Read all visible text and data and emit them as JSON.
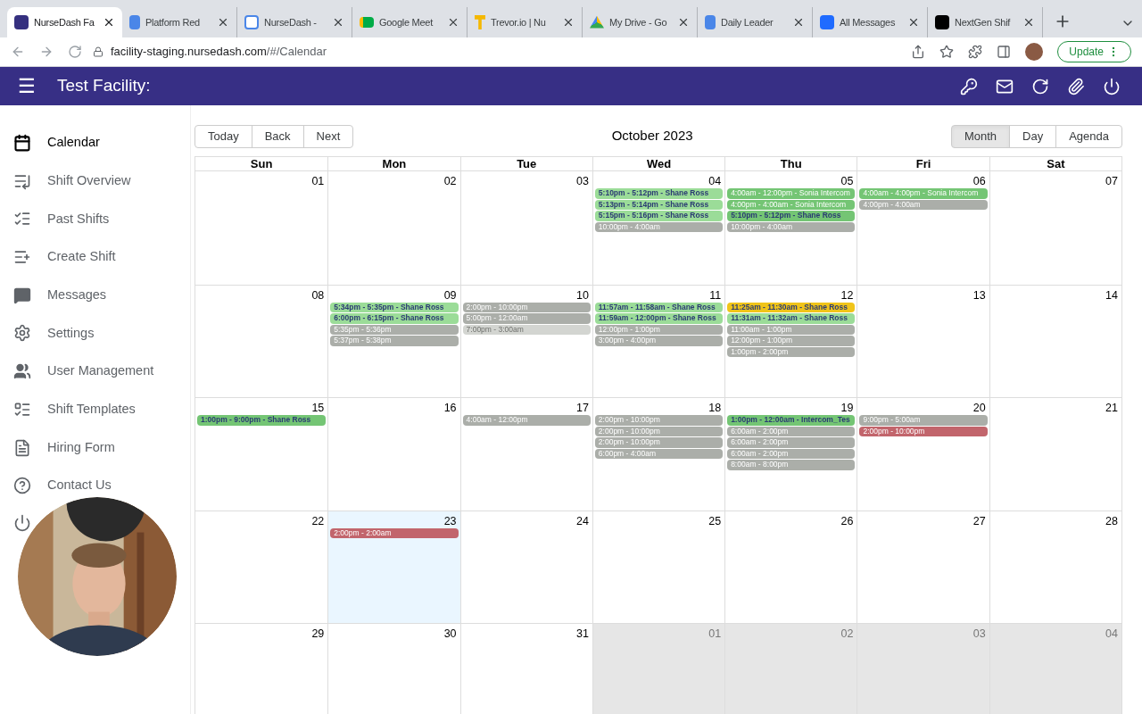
{
  "browser": {
    "tabs": [
      {
        "title": "NurseDash Fa",
        "selected": true
      },
      {
        "title": "Platform Red",
        "selected": false
      },
      {
        "title": "NurseDash -",
        "selected": false
      },
      {
        "title": "Google Meet",
        "selected": false
      },
      {
        "title": "Trevor.io | Nu",
        "selected": false
      },
      {
        "title": "My Drive - Go",
        "selected": false
      },
      {
        "title": "Daily Leader",
        "selected": false
      },
      {
        "title": "All Messages",
        "selected": false
      },
      {
        "title": "NextGen Shif",
        "selected": false
      }
    ],
    "url_host": "facility-staging.nursedash.com",
    "url_path": "/#/Calendar",
    "update_button": "Update"
  },
  "header": {
    "menu_icon": "☰",
    "title": "Test Facility:"
  },
  "sidebar": {
    "items": [
      {
        "label": "Calendar",
        "selected": true
      },
      {
        "label": "Shift Overview",
        "selected": false
      },
      {
        "label": "Past Shifts",
        "selected": false
      },
      {
        "label": "Create Shift",
        "selected": false
      },
      {
        "label": "Messages",
        "selected": false
      },
      {
        "label": "Settings",
        "selected": false
      },
      {
        "label": "User Management",
        "selected": false
      },
      {
        "label": "Shift Templates",
        "selected": false
      },
      {
        "label": "Hiring Form",
        "selected": false
      },
      {
        "label": "Contact Us",
        "selected": false
      }
    ]
  },
  "calendar": {
    "nav": [
      "Today",
      "Back",
      "Next"
    ],
    "title": "October 2023",
    "views": [
      {
        "label": "Month",
        "selected": true
      },
      {
        "label": "Day",
        "selected": false
      },
      {
        "label": "Agenda",
        "selected": false
      }
    ],
    "weekdays": [
      "Sun",
      "Mon",
      "Tue",
      "Wed",
      "Thu",
      "Fri",
      "Sat"
    ],
    "cells": [
      {
        "day": "01",
        "other_month": false,
        "today": false
      },
      {
        "day": "02",
        "other_month": false,
        "today": false
      },
      {
        "day": "03",
        "other_month": false,
        "today": false
      },
      {
        "day": "04",
        "other_month": false,
        "today": false,
        "events": [
          {
            "text": "5:10pm - 5:12pm - Shane Ross",
            "color": "#9bdc98",
            "kind": "bold"
          },
          {
            "text": "5:13pm - 5:14pm - Shane Ross",
            "color": "#9bdc98",
            "kind": "bold"
          },
          {
            "text": "5:15pm - 5:16pm - Shane Ross",
            "color": "#9bdc98",
            "kind": "bold"
          },
          {
            "text": "10:00pm - 4:00am",
            "color": "#abaea9",
            "kind": "plain"
          }
        ]
      },
      {
        "day": "05",
        "other_month": false,
        "today": false,
        "events": [
          {
            "text": "4:00am - 12:00pm - Sonia Intercom",
            "color": "#74c574",
            "kind": "plain"
          },
          {
            "text": "4:00pm - 4:00am - Sonia Intercom",
            "color": "#74c574",
            "kind": "plain"
          },
          {
            "text": "5:10pm - 5:12pm - Shane Ross",
            "color": "#74c574",
            "kind": "bold"
          },
          {
            "text": "10:00pm - 4:00am",
            "color": "#abaea9",
            "kind": "plain"
          }
        ]
      },
      {
        "day": "06",
        "other_month": false,
        "today": false,
        "events": [
          {
            "text": "4:00am - 4:00pm - Sonia Intercom",
            "color": "#74c574",
            "kind": "plain"
          },
          {
            "text": "4:00pm - 4:00am",
            "color": "#abaea9",
            "kind": "plain"
          }
        ]
      },
      {
        "day": "07",
        "other_month": false,
        "today": false
      },
      {
        "day": "08",
        "other_month": false,
        "today": false
      },
      {
        "day": "09",
        "other_month": false,
        "today": false,
        "events": [
          {
            "text": "5:34pm - 5:35pm - Shane Ross",
            "color": "#9bdc98",
            "kind": "bold"
          },
          {
            "text": "6:00pm - 6:15pm - Shane Ross",
            "color": "#9bdc98",
            "kind": "bold"
          },
          {
            "text": "5:35pm - 5:36pm",
            "color": "#abaea9",
            "kind": "plain"
          },
          {
            "text": "5:37pm - 5:38pm",
            "color": "#abaea9",
            "kind": "plain"
          }
        ]
      },
      {
        "day": "10",
        "other_month": false,
        "today": false,
        "events": [
          {
            "text": "2:00pm - 10:00pm",
            "color": "#abaea9",
            "kind": "plain"
          },
          {
            "text": "5:00pm - 12:00am",
            "color": "#abaea9",
            "kind": "plain"
          },
          {
            "text": "7:00pm - 3:00am",
            "color": "#d3d5d1",
            "kind": "faded"
          }
        ]
      },
      {
        "day": "11",
        "other_month": false,
        "today": false,
        "events": [
          {
            "text": "11:57am - 11:58am - Shane Ross",
            "color": "#9bdc98",
            "kind": "bold"
          },
          {
            "text": "11:59am - 12:00pm - Shane Ross",
            "color": "#9bdc98",
            "kind": "bold"
          },
          {
            "text": "12:00pm - 1:00pm",
            "color": "#abaea9",
            "kind": "plain"
          },
          {
            "text": "3:00pm - 4:00pm",
            "color": "#abaea9",
            "kind": "plain"
          }
        ]
      },
      {
        "day": "12",
        "other_month": false,
        "today": false,
        "events": [
          {
            "text": "11:25am - 11:30am - Shane Ross",
            "color": "#f0c419",
            "kind": "bold"
          },
          {
            "text": "11:31am - 11:32am - Shane Ross",
            "color": "#9bdc98",
            "kind": "bold"
          },
          {
            "text": "11:00am - 1:00pm",
            "color": "#abaea9",
            "kind": "plain"
          },
          {
            "text": "12:00pm - 1:00pm",
            "color": "#abaea9",
            "kind": "plain"
          },
          {
            "text": "1:00pm - 2:00pm",
            "color": "#abaea9",
            "kind": "plain"
          }
        ]
      },
      {
        "day": "13",
        "other_month": false,
        "today": false
      },
      {
        "day": "14",
        "other_month": false,
        "today": false
      },
      {
        "day": "15",
        "other_month": false,
        "today": false,
        "events": [
          {
            "text": "1:00pm - 9:00pm - Shane Ross",
            "color": "#74c574",
            "kind": "bold"
          }
        ]
      },
      {
        "day": "16",
        "other_month": false,
        "today": false
      },
      {
        "day": "17",
        "other_month": false,
        "today": false,
        "events": [
          {
            "text": "4:00am - 12:00pm",
            "color": "#abaea9",
            "kind": "plain"
          }
        ]
      },
      {
        "day": "18",
        "other_month": false,
        "today": false,
        "events": [
          {
            "text": "2:00pm - 10:00pm",
            "color": "#abaea9",
            "kind": "plain"
          },
          {
            "text": "2:00pm - 10:00pm",
            "color": "#abaea9",
            "kind": "plain"
          },
          {
            "text": "2:00pm - 10:00pm",
            "color": "#abaea9",
            "kind": "plain"
          },
          {
            "text": "6:00pm - 4:00am",
            "color": "#abaea9",
            "kind": "plain"
          }
        ]
      },
      {
        "day": "19",
        "other_month": false,
        "today": false,
        "events": [
          {
            "text": "1:00pm - 12:00am - Intercom_Tes",
            "color": "#74c574",
            "kind": "bold"
          },
          {
            "text": "6:00am - 2:00pm",
            "color": "#abaea9",
            "kind": "plain"
          },
          {
            "text": "6:00am - 2:00pm",
            "color": "#abaea9",
            "kind": "plain"
          },
          {
            "text": "6:00am - 2:00pm",
            "color": "#abaea9",
            "kind": "plain"
          },
          {
            "text": "8:00am - 8:00pm",
            "color": "#abaea9",
            "kind": "plain"
          }
        ]
      },
      {
        "day": "20",
        "other_month": false,
        "today": false,
        "events": [
          {
            "text": "9:00pm - 5:00am",
            "color": "#abaea9",
            "kind": "plain"
          },
          {
            "text": "2:00pm - 10:00pm",
            "color": "#c2656c",
            "kind": "plain"
          }
        ]
      },
      {
        "day": "21",
        "other_month": false,
        "today": false
      },
      {
        "day": "22",
        "other_month": false,
        "today": false
      },
      {
        "day": "23",
        "other_month": false,
        "today": true,
        "events": [
          {
            "text": "2:00pm - 2:00am",
            "color": "#c2656c",
            "kind": "plain"
          }
        ]
      },
      {
        "day": "24",
        "other_month": false,
        "today": false
      },
      {
        "day": "25",
        "other_month": false,
        "today": false
      },
      {
        "day": "26",
        "other_month": false,
        "today": false
      },
      {
        "day": "27",
        "other_month": false,
        "today": false
      },
      {
        "day": "28",
        "other_month": false,
        "today": false
      },
      {
        "day": "29",
        "other_month": false,
        "today": false
      },
      {
        "day": "30",
        "other_month": false,
        "today": false
      },
      {
        "day": "31",
        "other_month": false,
        "today": false
      },
      {
        "day": "01",
        "other_month": true,
        "today": false
      },
      {
        "day": "02",
        "other_month": true,
        "today": false
      },
      {
        "day": "03",
        "other_month": true,
        "today": false
      },
      {
        "day": "04",
        "other_month": true,
        "today": false
      }
    ]
  }
}
